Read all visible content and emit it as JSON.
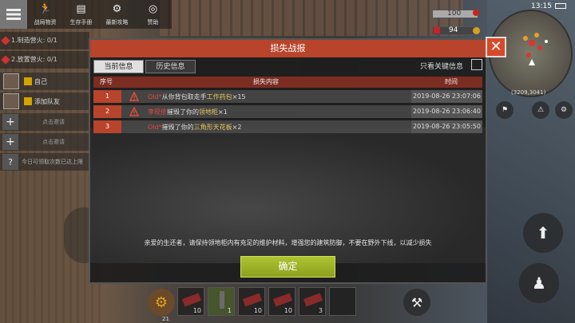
{
  "toolbar": {
    "items": [
      {
        "label": "战局物资",
        "icon": "runner-icon"
      },
      {
        "label": "生存手册",
        "icon": "handbook-icon"
      },
      {
        "label": "最新攻略",
        "icon": "strategy-icon"
      },
      {
        "label": "赞助",
        "icon": "sponsor-icon"
      }
    ]
  },
  "tasks": [
    {
      "label": "1.制造营火: 0/1"
    },
    {
      "label": "2.放置营火: 0/1"
    }
  ],
  "team": [
    {
      "name": "自己"
    },
    {
      "name": "添加队友"
    }
  ],
  "side_rows": [
    {
      "label": "点击邀请"
    },
    {
      "label": "点击邀请"
    },
    {
      "label": "今日可领取次数已达上限"
    }
  ],
  "hud": {
    "bar1_value": "100",
    "bar2_value": "94",
    "time": "13:15",
    "coords": "(3209,3041)"
  },
  "dialog": {
    "title": "损失战报",
    "tabs": [
      {
        "label": "当前信息",
        "active": true
      },
      {
        "label": "历史信息",
        "active": false
      }
    ],
    "key_only_label": "只看关键信息",
    "columns": {
      "index": "序号",
      "content": "损失内容",
      "time": "时间"
    },
    "rows": [
      {
        "index": "1",
        "actor": "Old*",
        "text_before": "从你背包取走手",
        "item": "工作药包",
        "qty": "×15",
        "time": "2019-08-26 23:07:06",
        "warning": true
      },
      {
        "index": "2",
        "actor": "李现依",
        "text_before": "摧毁了你的",
        "item": "领地柜",
        "qty": "×1",
        "time": "2019-08-26 23:06:40",
        "warning": true
      },
      {
        "index": "3",
        "actor": "Old*",
        "text_before": "摧毁了你的",
        "item": "三角形天花板",
        "qty": "×2",
        "time": "2019-08-26 23:05:50",
        "warning": false
      }
    ],
    "notice": "亲爱的生还者，请保持领地柜内有充足的维护材料，增强您的建筑防御，不要在野外下线，以减少损失",
    "confirm_label": "确定"
  },
  "hotbar": {
    "slots": [
      {
        "count": "10"
      },
      {
        "count": "1"
      },
      {
        "count": "10"
      },
      {
        "count": "10"
      },
      {
        "count": "3"
      },
      {
        "count": ""
      }
    ],
    "gear_count": "21"
  },
  "colors": {
    "accent": "#b8442c",
    "confirm": "#9bb227",
    "actor": "#e24a3a",
    "item": "#e7c85d"
  }
}
